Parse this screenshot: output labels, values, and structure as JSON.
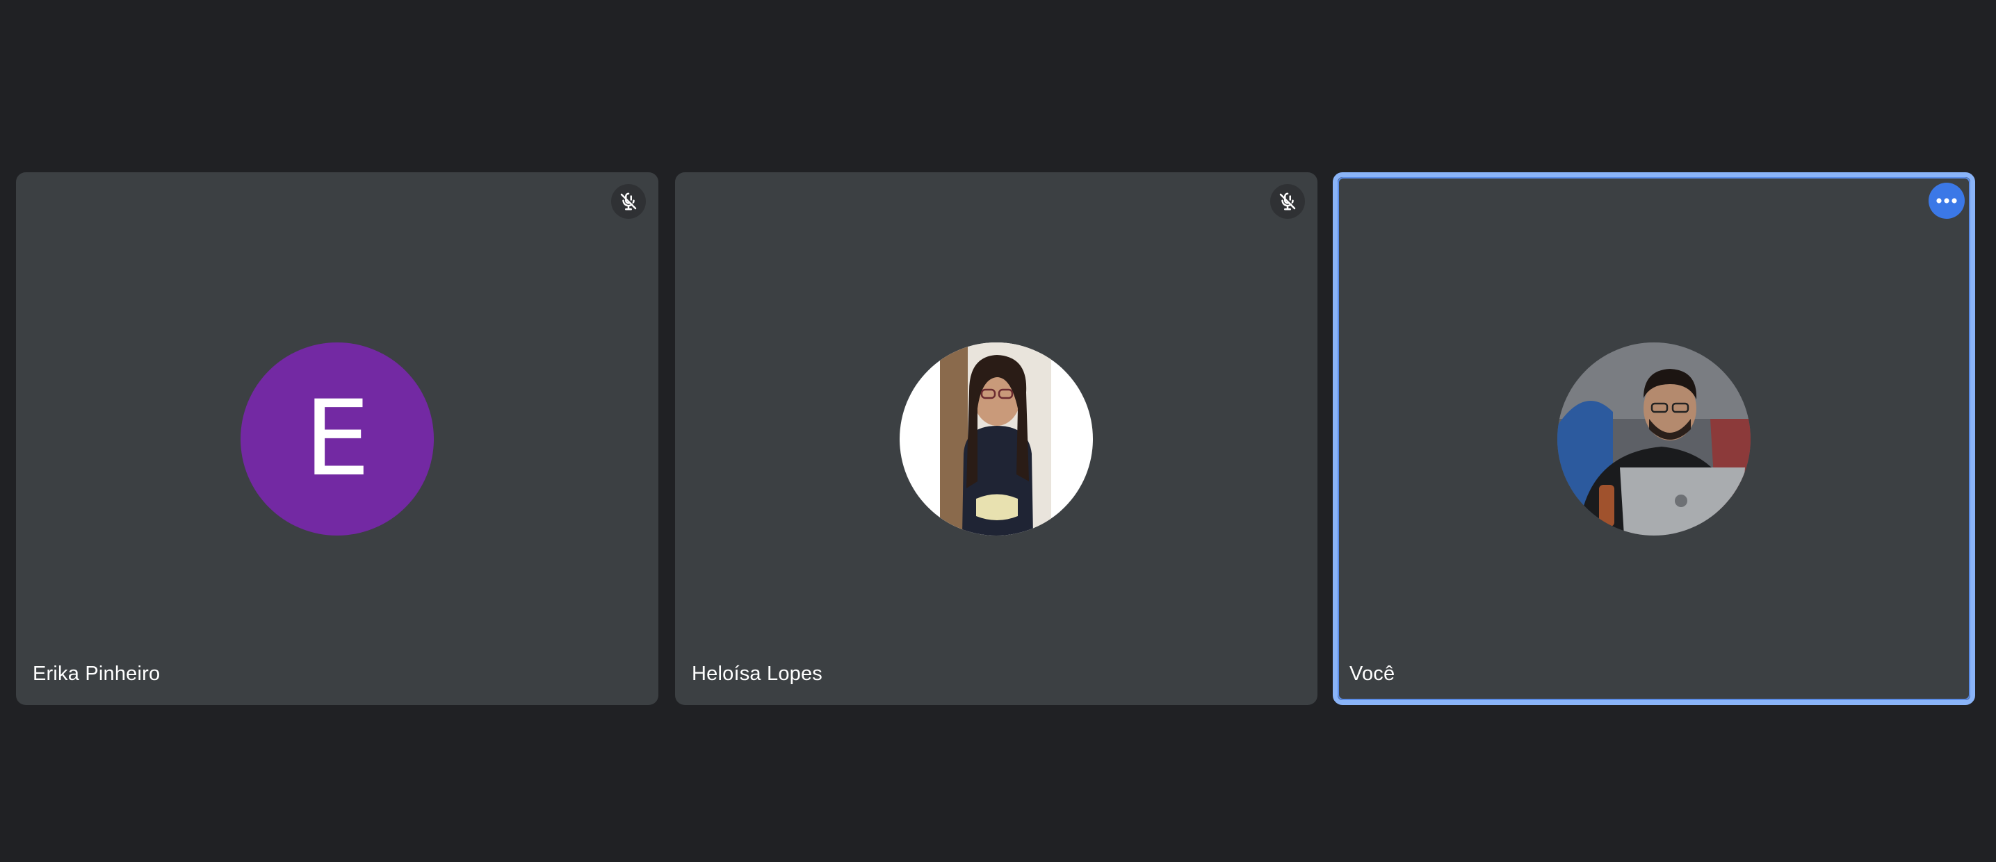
{
  "participants": [
    {
      "name": "Erika Pinheiro",
      "avatar_type": "letter",
      "avatar_letter": "E",
      "avatar_color": "#7329a3",
      "muted": true,
      "icon": "mic-off-icon"
    },
    {
      "name": "Heloísa Lopes",
      "avatar_type": "photo",
      "muted": true,
      "icon": "mic-off-icon"
    },
    {
      "name": "Você",
      "avatar_type": "photo",
      "active_speaker": true,
      "highlight_color": "#8ab4f8",
      "icon": "more-options-icon"
    }
  ],
  "theme": {
    "background": "#202124",
    "tile_background": "#3c4043",
    "accent": "#3b78e7"
  }
}
